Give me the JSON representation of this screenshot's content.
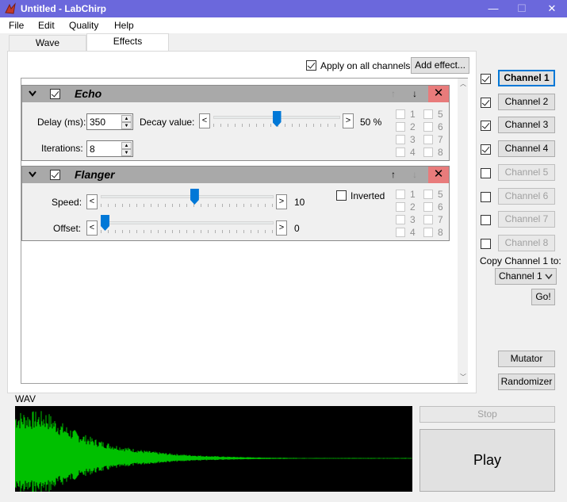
{
  "window": {
    "title": "Untitled - LabChirp",
    "buttons": {
      "minimize": "—",
      "maximize": "☐",
      "close": "✕"
    }
  },
  "menu": [
    "File",
    "Edit",
    "Quality",
    "Help"
  ],
  "tabs": [
    {
      "label": "Wave",
      "active": false
    },
    {
      "label": "Effects",
      "active": true
    }
  ],
  "effects_panel": {
    "apply_all_label": "Apply on all channels",
    "apply_all_checked": true,
    "add_effect_label": "Add effect...",
    "effects": [
      {
        "name": "Echo",
        "enabled": true,
        "up_enabled": false,
        "down_enabled": true,
        "fields": {
          "delay_label": "Delay (ms):",
          "delay_value": "350",
          "iterations_label": "Iterations:",
          "iterations_value": "8",
          "decay_label": "Decay value:",
          "decay_value": "50 %",
          "decay_level": 0.5
        },
        "channel_boxes": [
          "1",
          "5",
          "2",
          "6",
          "3",
          "7",
          "4",
          "8"
        ]
      },
      {
        "name": "Flanger",
        "enabled": true,
        "up_enabled": true,
        "down_enabled": false,
        "fields": {
          "speed_label": "Speed:",
          "speed_value": "10",
          "speed_level": 0.54,
          "offset_label": "Offset:",
          "offset_value": "0",
          "offset_level": 0.0,
          "inverted_label": "Inverted",
          "inverted_checked": false
        },
        "channel_boxes": [
          "1",
          "5",
          "2",
          "6",
          "3",
          "7",
          "4",
          "8"
        ]
      }
    ]
  },
  "channels": [
    {
      "label": "Channel 1",
      "checked": true,
      "selected": true,
      "enabled": true
    },
    {
      "label": "Channel 2",
      "checked": true,
      "selected": false,
      "enabled": true
    },
    {
      "label": "Channel 3",
      "checked": true,
      "selected": false,
      "enabled": true
    },
    {
      "label": "Channel 4",
      "checked": true,
      "selected": false,
      "enabled": true
    },
    {
      "label": "Channel 5",
      "checked": false,
      "selected": false,
      "enabled": false
    },
    {
      "label": "Channel 6",
      "checked": false,
      "selected": false,
      "enabled": false
    },
    {
      "label": "Channel 7",
      "checked": false,
      "selected": false,
      "enabled": false
    },
    {
      "label": "Channel 8",
      "checked": false,
      "selected": false,
      "enabled": false
    }
  ],
  "copy": {
    "label": "Copy Channel 1 to:",
    "target": "Channel 1",
    "go_label": "Go!"
  },
  "tools": {
    "mutator": "Mutator",
    "randomizer": "Randomizer"
  },
  "wave": {
    "label": "WAV",
    "color": "#00c000"
  },
  "playback": {
    "stop": "Stop",
    "play": "Play"
  },
  "colors": {
    "titlebar": "#6b68dc",
    "accent": "#0078d7",
    "close_effect": "#e87b7b"
  }
}
